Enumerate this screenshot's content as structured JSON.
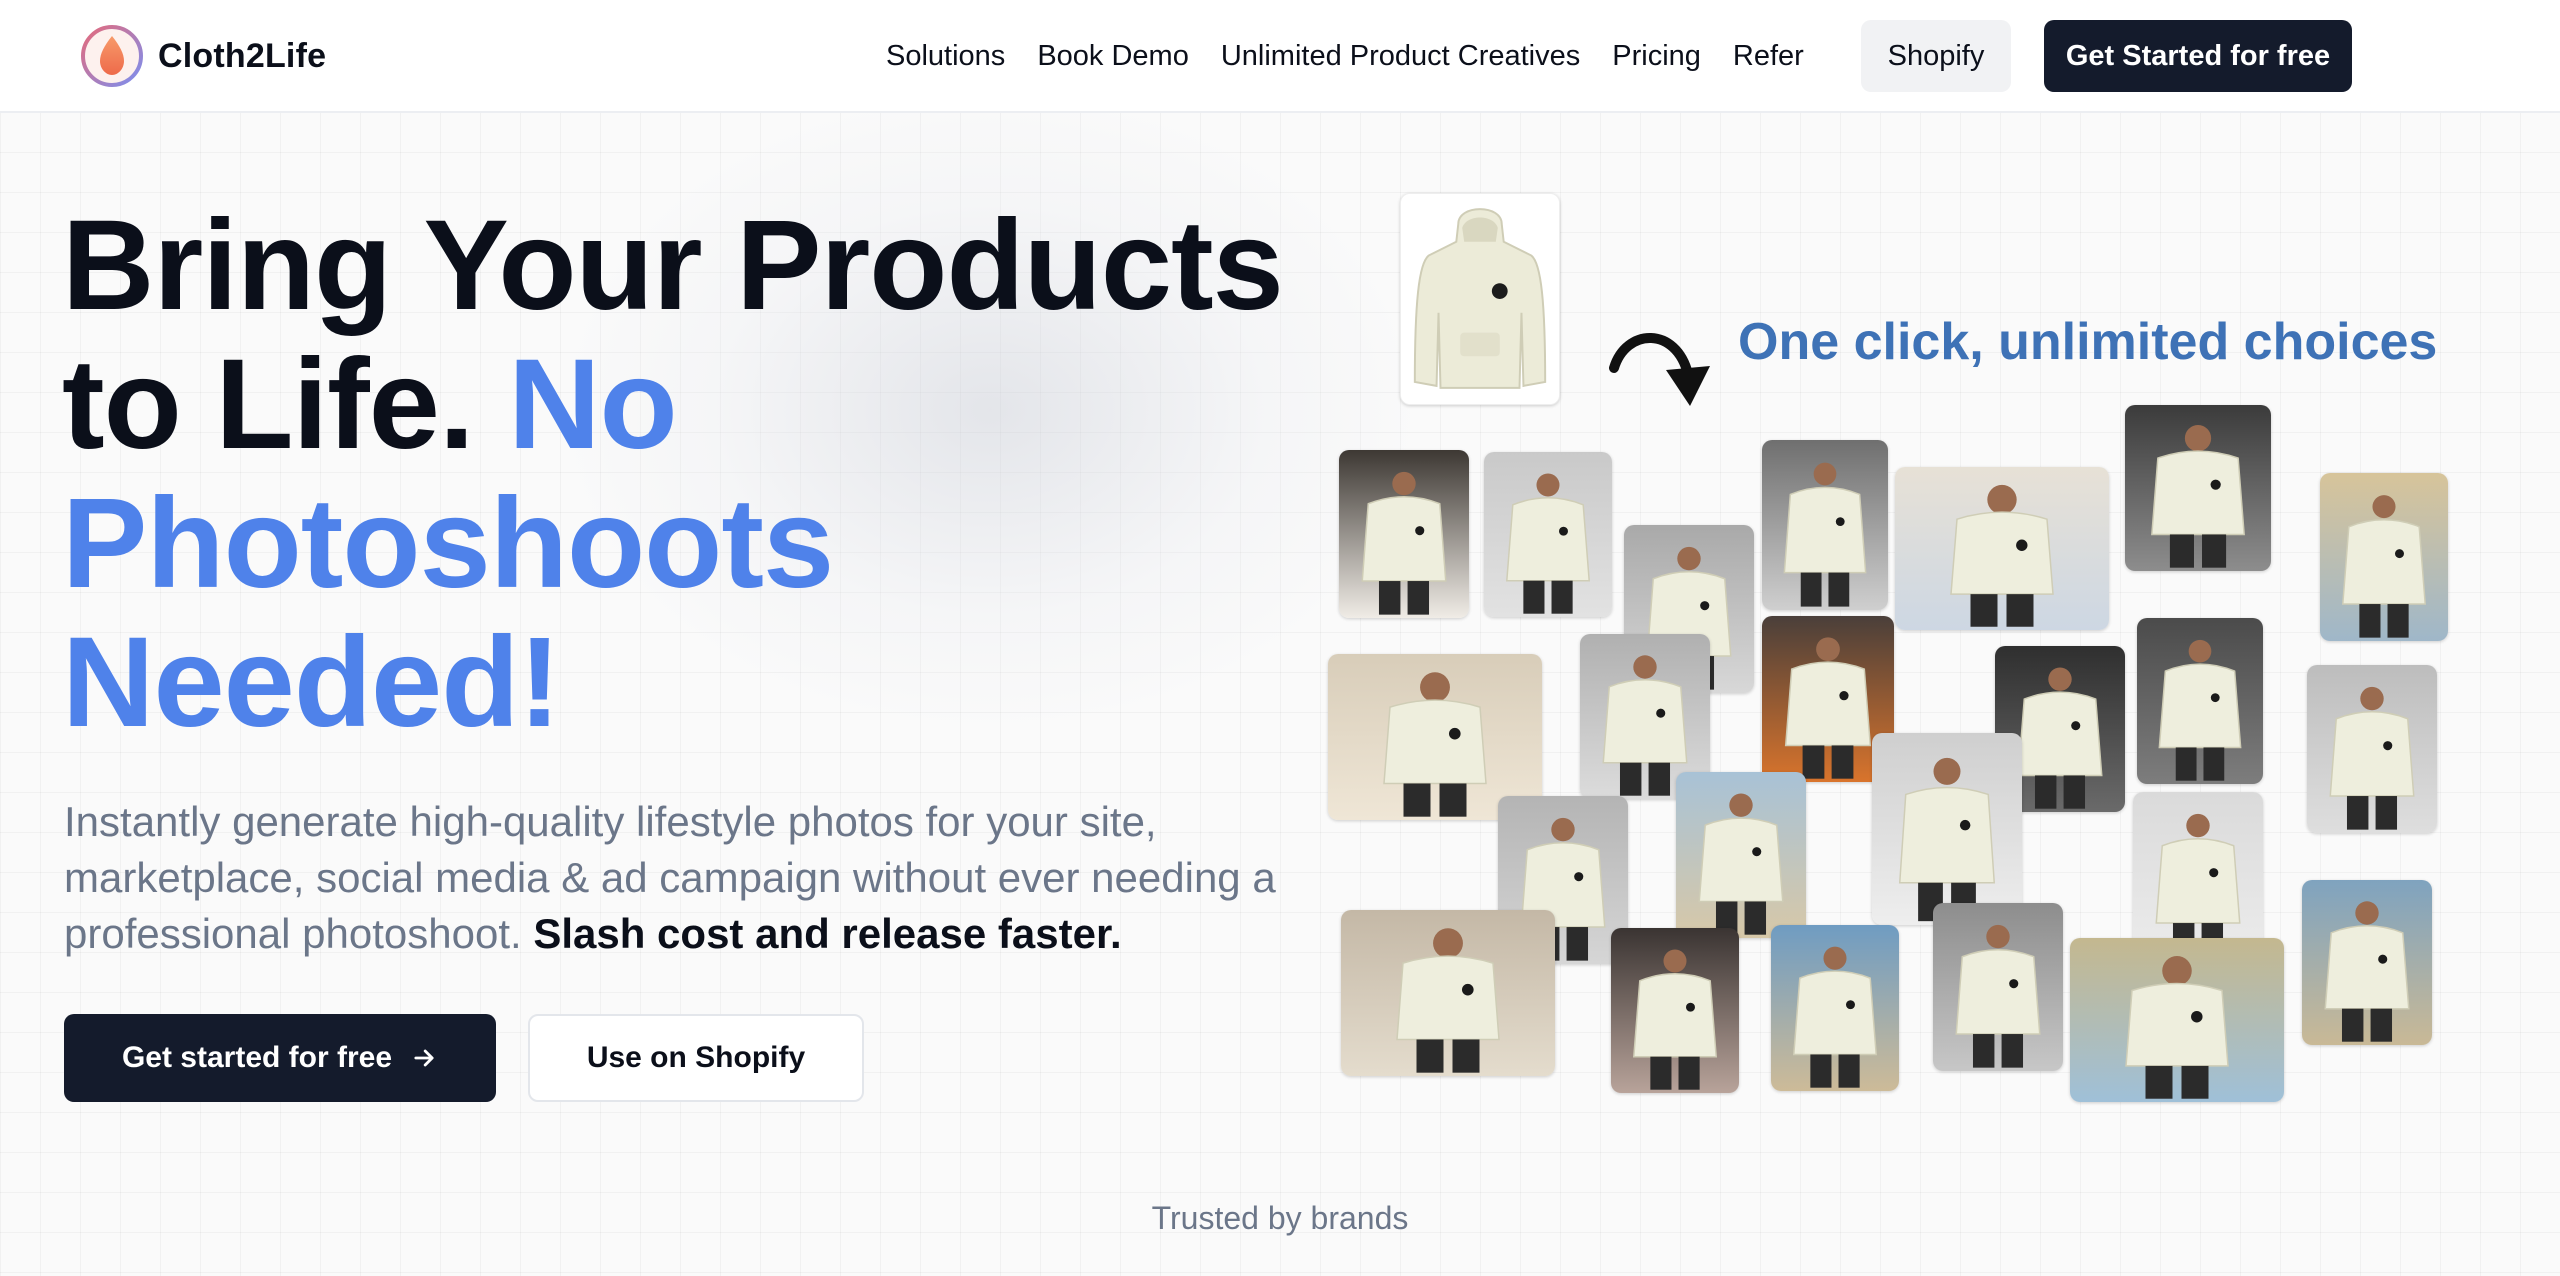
{
  "brand": {
    "name": "Cloth2Life"
  },
  "nav": {
    "links": [
      "Solutions",
      "Book Demo",
      "Unlimited Product Creatives",
      "Pricing",
      "Refer"
    ],
    "shopify_label": "Shopify",
    "cta_label": "Get Started for free"
  },
  "hero": {
    "headline_dark": "Bring Your Products to Life.",
    "headline_accent": "No Photoshoots Needed!",
    "subtext": "Instantly generate high-quality lifestyle photos for your site, marketplace, social media & ad campaign without ever needing a professional photoshoot.",
    "subtext_strong": "Slash cost and release faster.",
    "primary_cta": "Get started for free",
    "secondary_cta": "Use on Shopify"
  },
  "collage": {
    "tagline": "One click, unlimited choices"
  },
  "footer_strip": {
    "trusted_label": "Trusted by brands"
  },
  "colors": {
    "accent_blue": "#4f82ea",
    "dark_button": "#141b2c",
    "tagline_blue": "#3e72b6",
    "hoodie_cream": "#eeeedd"
  },
  "icons": [
    "logo-icon",
    "arrow-right-icon",
    "curved-arrow-icon",
    "hoodie-image"
  ]
}
